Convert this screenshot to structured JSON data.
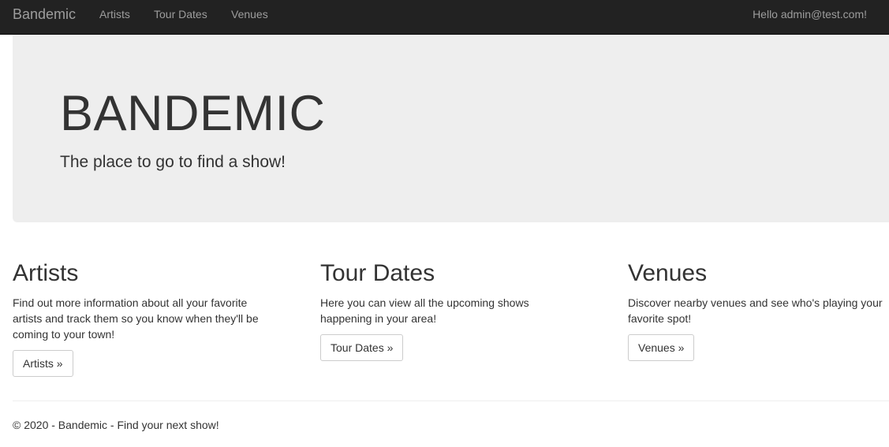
{
  "navbar": {
    "brand": "Bandemic",
    "links": [
      {
        "label": "Artists"
      },
      {
        "label": "Tour Dates"
      },
      {
        "label": "Venues"
      }
    ],
    "greeting": "Hello admin@test.com!"
  },
  "jumbotron": {
    "title": "BANDEMIC",
    "subtitle": "The place to go to find a show!"
  },
  "sections": [
    {
      "heading": "Artists",
      "text": "Find out more information about all your favorite artists and track them so you know when they'll be coming to your town!",
      "button": "Artists »"
    },
    {
      "heading": "Tour Dates",
      "text": "Here you can view all the upcoming shows happening in your area!",
      "button": "Tour Dates »"
    },
    {
      "heading": "Venues",
      "text": "Discover nearby venues and see who's playing your favorite spot!",
      "button": "Venues »"
    }
  ],
  "footer": {
    "text": "© 2020 - Bandemic - Find your next show!"
  },
  "colors": {
    "navbar_bg": "#222222",
    "navbar_text": "#9d9d9d",
    "jumbotron_bg": "#eeeeee",
    "body_text": "#333333"
  }
}
